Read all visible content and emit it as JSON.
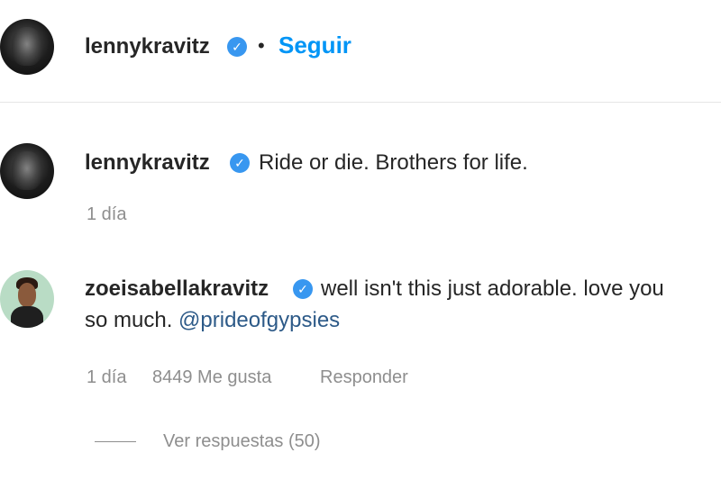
{
  "header": {
    "username": "lennykravitz",
    "separator": "•",
    "follow_label": "Seguir"
  },
  "caption": {
    "username": "lennykravitz",
    "text": "Ride or die. Brothers for life.",
    "time": "1 día"
  },
  "comment": {
    "username": "zoeisabellakravitz",
    "text_line1": "well isn't this just adorable. love you",
    "text_line2": "so much.",
    "mention": "@prideofgypsies",
    "time": "1 día",
    "likes": "8449 Me gusta",
    "reply_label": "Responder",
    "view_replies": "Ver respuestas (50)"
  },
  "icons": {
    "verified": "verified-badge-icon",
    "check_glyph": "✓"
  },
  "colors": {
    "accent": "#0095f6",
    "verified": "#3897f0",
    "mention": "#2d5a88",
    "meta": "#8e8e8e"
  }
}
